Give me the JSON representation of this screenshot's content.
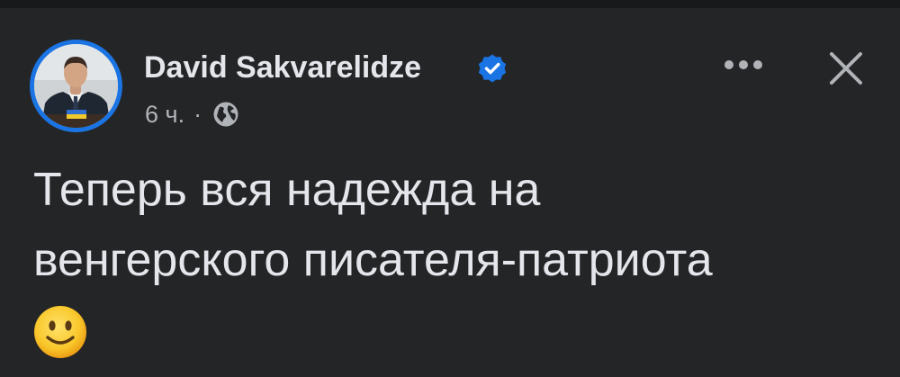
{
  "post": {
    "author_name": "David Sakvarelidze",
    "verified": true,
    "timestamp": "6 ч.",
    "separator": "·",
    "audience_icon": "globe-icon",
    "text_line1": "Теперь вся надежда на",
    "text_line2": "венгерского писателя-патриота",
    "emoji": "slightly-smiling-face"
  },
  "header_actions": {
    "more_icon": "more-horizontal-icon",
    "close_icon": "close-icon"
  },
  "colors": {
    "background": "#242526",
    "primary_text": "#e4e6eb",
    "secondary_text": "#b0b3b8",
    "accent": "#1b74e4",
    "verified_badge": "#1b74e4"
  }
}
